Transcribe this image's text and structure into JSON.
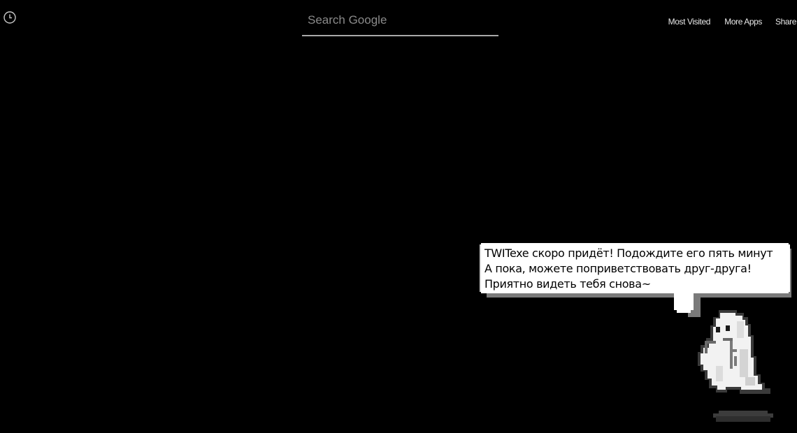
{
  "header": {
    "history_icon": "clock-icon",
    "search": {
      "placeholder": "Search Google",
      "value": ""
    },
    "links": [
      {
        "label": "Most Visited"
      },
      {
        "label": "More Apps"
      },
      {
        "label": "Share"
      }
    ]
  },
  "mascot": {
    "icon": "pixel-ghost-icon",
    "speech_lines": [
      "TWITexe скоро придёт! Подождите его пять минут",
      "А пока, можете поприветствовать друг-друга!",
      "Приятно видеть тебя снова~"
    ]
  },
  "colors": {
    "background": "#000000",
    "text": "#e8e8e8",
    "search_underline": "#a8a8a8",
    "bubble_fill": "#ffffff",
    "bubble_shadow": "#7a7a7a"
  }
}
